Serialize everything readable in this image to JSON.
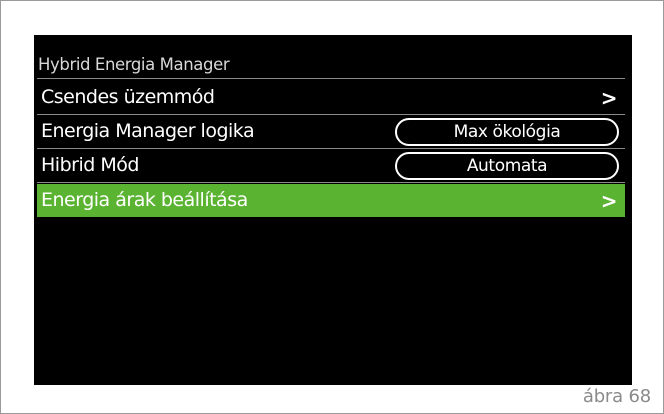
{
  "menu": {
    "title": "Hybrid Energia Manager",
    "items": [
      {
        "label": "Csendes üzemmód",
        "chevron": ">",
        "value": null,
        "selected": false
      },
      {
        "label": "Energia Manager logika",
        "chevron": null,
        "value": "Max ökológia",
        "selected": false
      },
      {
        "label": "Hibrid Mód",
        "chevron": null,
        "value": "Automata",
        "selected": false
      },
      {
        "label": "Energia árak beállítása",
        "chevron": ">",
        "value": null,
        "selected": true
      }
    ]
  },
  "caption": "ábra 68",
  "colors": {
    "screen_bg": "#000000",
    "highlight": "#5ab331",
    "divider": "#8a8a8a"
  }
}
